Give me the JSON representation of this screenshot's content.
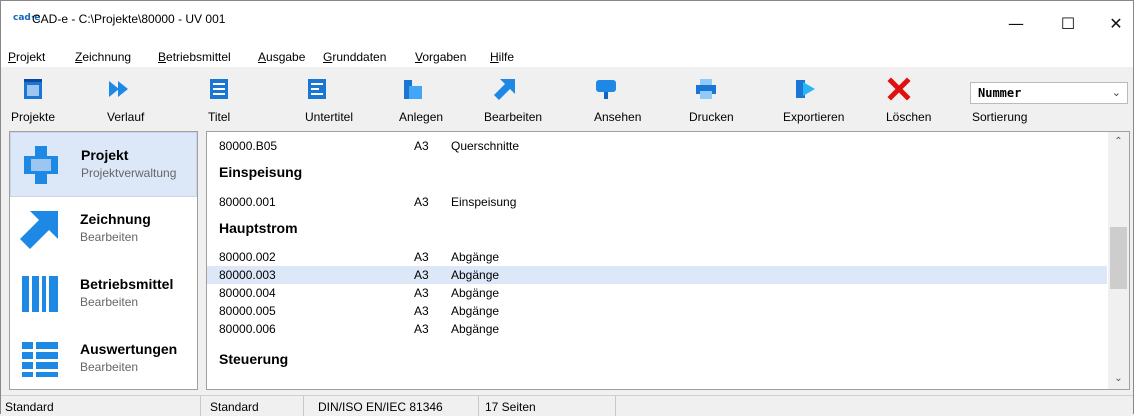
{
  "window": {
    "logo_text": "cad·e",
    "title": "CAD-e - C:\\Projekte\\80000 - UV 001",
    "controls": {
      "minimize": "—",
      "maximize": "☐",
      "close": "✕"
    }
  },
  "menu": [
    {
      "acc": "P",
      "rest": "rojekt"
    },
    {
      "acc": "Z",
      "rest": "eichnung"
    },
    {
      "acc": "B",
      "rest": "etriebsmittel"
    },
    {
      "acc": "A",
      "rest": "usgabe"
    },
    {
      "acc": "G",
      "rest": "runddaten"
    },
    {
      "acc": "V",
      "rest": "orgaben"
    },
    {
      "acc": "H",
      "rest": "ilfe"
    }
  ],
  "toolbar": {
    "buttons": [
      {
        "label": "Projekte",
        "icon": "projects-icon"
      },
      {
        "label": "Verlauf",
        "icon": "history-forward-icon"
      },
      {
        "label": "Titel",
        "icon": "title-sheet-icon"
      },
      {
        "label": "Untertitel",
        "icon": "subtitle-sheet-icon"
      },
      {
        "label": "Anlegen",
        "icon": "create-icon"
      },
      {
        "label": "Bearbeiten",
        "icon": "edit-arrow-icon"
      },
      {
        "label": "Ansehen",
        "icon": "view-icon"
      },
      {
        "label": "Drucken",
        "icon": "printer-icon"
      },
      {
        "label": "Exportieren",
        "icon": "export-icon"
      },
      {
        "label": "Löschen",
        "icon": "delete-x-icon"
      }
    ],
    "sort": {
      "value": "Nummer",
      "label": "Sortierung"
    }
  },
  "nav": [
    {
      "title": "Projekt",
      "subtitle": "Projektverwaltung",
      "icon": "project-icon",
      "selected": true
    },
    {
      "title": "Zeichnung",
      "subtitle": "Bearbeiten",
      "icon": "drawing-arrow-icon",
      "selected": false
    },
    {
      "title": "Betriebsmittel",
      "subtitle": "Bearbeiten",
      "icon": "equipment-icon",
      "selected": false
    },
    {
      "title": "Auswertungen",
      "subtitle": "Bearbeiten",
      "icon": "reports-icon",
      "selected": false
    }
  ],
  "list": {
    "items": [
      {
        "kind": "row",
        "number": "80000.B05",
        "format": "A3",
        "description": "Querschnitte"
      },
      {
        "kind": "group",
        "title": "Einspeisung"
      },
      {
        "kind": "row",
        "number": "80000.001",
        "format": "A3",
        "description": "Einspeisung"
      },
      {
        "kind": "group",
        "title": "Hauptstrom"
      },
      {
        "kind": "row",
        "number": "80000.002",
        "format": "A3",
        "description": "Abgänge"
      },
      {
        "kind": "row",
        "number": "80000.003",
        "format": "A3",
        "description": "Abgänge",
        "selected": true
      },
      {
        "kind": "row",
        "number": "80000.004",
        "format": "A3",
        "description": "Abgänge"
      },
      {
        "kind": "row",
        "number": "80000.005",
        "format": "A3",
        "description": "Abgänge"
      },
      {
        "kind": "row",
        "number": "80000.006",
        "format": "A3",
        "description": "Abgänge"
      },
      {
        "kind": "group",
        "title": "Steuerung"
      }
    ]
  },
  "status": [
    "Standard",
    "Standard",
    "DIN/ISO EN/IEC 81346",
    "17 Seiten"
  ],
  "colors": {
    "accent_blue": "#1976d2",
    "delete_red": "#e01010",
    "selection": "#dce8f8"
  }
}
